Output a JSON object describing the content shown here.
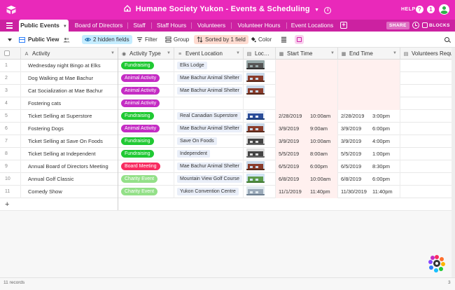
{
  "base": {
    "title": "Humane Society Yukon - Events & Scheduling",
    "help": "HELP",
    "notification_badge": "1",
    "question_mark": "?"
  },
  "tabs": [
    {
      "label": "Public Events"
    },
    {
      "label": "Board of Directors"
    },
    {
      "label": "Staff"
    },
    {
      "label": "Staff Hours"
    },
    {
      "label": "Volunteers"
    },
    {
      "label": "Volunteer Hours"
    },
    {
      "label": "Event Locations"
    }
  ],
  "tabbar": {
    "share": "SHARE",
    "blocks": "BLOCKS"
  },
  "toolbar": {
    "view_name": "Public View",
    "hidden_fields": "2 hidden fields",
    "filter": "Filter",
    "group": "Group",
    "sorted": "Sorted by 1 field",
    "color": "Color"
  },
  "columns": [
    {
      "label": "Activity",
      "icon": "A"
    },
    {
      "label": "Activity Type",
      "icon": "◉"
    },
    {
      "label": "Event Location",
      "icon": "≡"
    },
    {
      "label": "Loc…",
      "icon": "▤"
    },
    {
      "label": "Start Time",
      "icon": "▦"
    },
    {
      "label": "End Time",
      "icon": "▦"
    },
    {
      "label": "Volunteers Requeste",
      "icon": "▤"
    }
  ],
  "type_colors": {
    "Fundraising": "#20c933",
    "Animal Activity": "#c42cc4",
    "Board Meeting": "#f82b60",
    "Charity Event": "#93e088"
  },
  "rows": [
    {
      "num": "1",
      "activity": "Wednesday night Bingo at Elks",
      "type": "Fundraising",
      "location": "Elks Lodge",
      "thumb": "building-dark",
      "start_date": "",
      "start_time": "",
      "end_date": "",
      "end_time": ""
    },
    {
      "num": "2",
      "activity": "Dog Walking at Mae Bachur",
      "type": "Animal Activity",
      "location": "Mae Bachur Animal Shelter",
      "thumb": "building-red",
      "start_date": "",
      "start_time": "",
      "end_date": "",
      "end_time": ""
    },
    {
      "num": "3",
      "activity": "Cat Socialization at Mae Bachur",
      "type": "Animal Activity",
      "location": "Mae Bachur Animal Shelter",
      "thumb": "building-red",
      "start_date": "",
      "start_time": "",
      "end_date": "",
      "end_time": ""
    },
    {
      "num": "4",
      "activity": "Fostering cats",
      "type": "Animal Activity",
      "location": "",
      "thumb": "",
      "start_date": "",
      "start_time": "",
      "end_date": "",
      "end_time": ""
    },
    {
      "num": "5",
      "activity": "Ticket Selling at Superstore",
      "type": "Fundraising",
      "location": "Real Canadian Superstore",
      "thumb": "store-blue",
      "start_date": "2/28/2019",
      "start_time": "10:00am",
      "end_date": "2/28/2019",
      "end_time": "3:00pm"
    },
    {
      "num": "6",
      "activity": "Fostering Dogs",
      "type": "Animal Activity",
      "location": "Mae Bachur Animal Shelter",
      "thumb": "building-red",
      "start_date": "3/9/2019",
      "start_time": "9:00am",
      "end_date": "3/9/2019",
      "end_time": "6:00pm"
    },
    {
      "num": "7",
      "activity": "Ticket Selling at Save On Foods",
      "type": "Fundraising",
      "location": "Save On Foods",
      "thumb": "store-dark",
      "start_date": "3/9/2019",
      "start_time": "10:00am",
      "end_date": "3/9/2019",
      "end_time": "4:00pm"
    },
    {
      "num": "8",
      "activity": "Ticket Selling at Independent",
      "type": "Fundraising",
      "location": "Independent",
      "thumb": "store-dark",
      "start_date": "5/5/2019",
      "start_time": "8:00am",
      "end_date": "5/5/2019",
      "end_time": "1:00pm"
    },
    {
      "num": "9",
      "activity": "Annual Board of Directors Meeting",
      "type": "Board Meeting",
      "location": "Mae Bachur Animal Shelter",
      "thumb": "building-red",
      "start_date": "6/5/2019",
      "start_time": "6:00pm",
      "end_date": "6/5/2019",
      "end_time": "8:30pm"
    },
    {
      "num": "10",
      "activity": "Annual Golf Classic",
      "type": "Charity Event",
      "location": "Mountain View Golf Course",
      "thumb": "golf-green",
      "start_date": "6/8/2019",
      "start_time": "10:00am",
      "end_date": "6/8/2019",
      "end_time": "6:00pm"
    },
    {
      "num": "11",
      "activity": "Comedy Show",
      "type": "Charity Event",
      "location": "Yukon Convention Centre",
      "thumb": "building-light",
      "start_date": "11/1/2019",
      "start_time": "11:40pm",
      "end_date": "11/30/2019",
      "end_time": "11:40pm"
    }
  ],
  "footer": {
    "records": "11 records",
    "right": "3"
  }
}
